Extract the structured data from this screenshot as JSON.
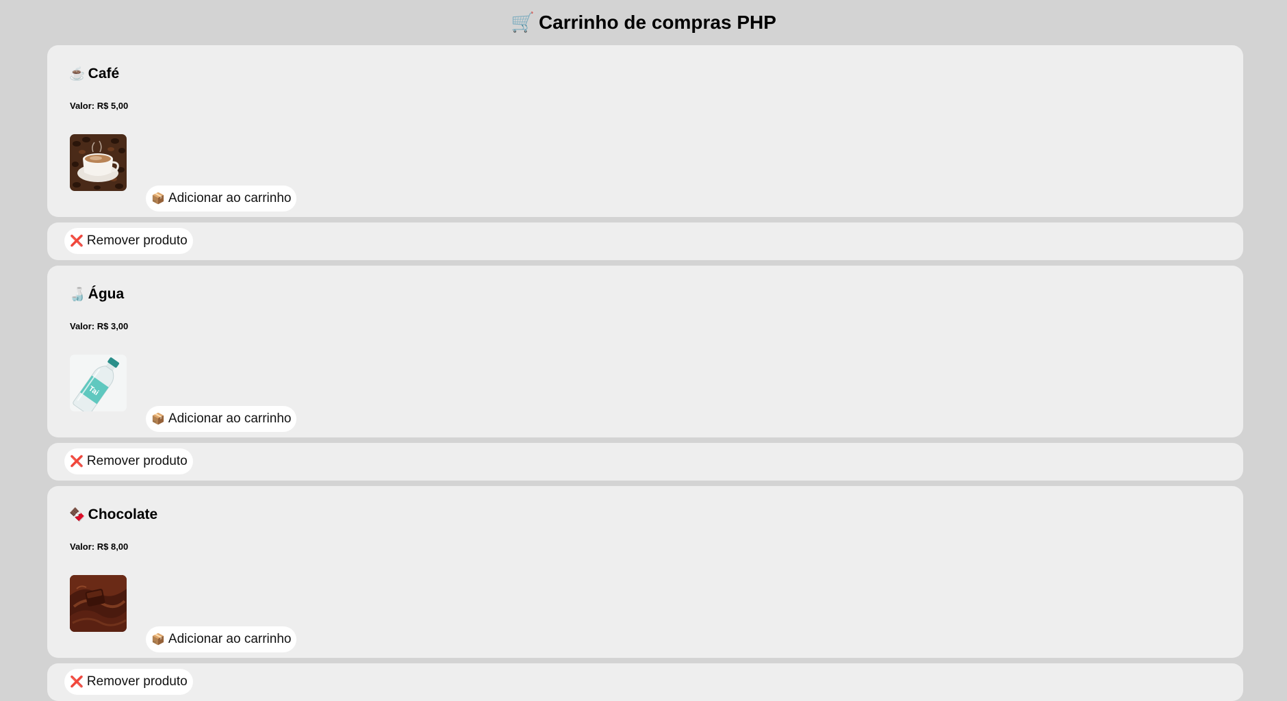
{
  "header": {
    "title": "Carrinho de compras PHP",
    "icon": "🛒"
  },
  "products": [
    {
      "icon": "☕",
      "name": "Café",
      "price": "Valor: R$ 5,00",
      "add_label": "Adicionar ao carrinho",
      "add_icon": "📦",
      "remove_label": "Remover produto",
      "remove_icon": "❌"
    },
    {
      "icon": "🍶",
      "name": "Água",
      "price": "Valor: R$ 3,00",
      "add_label": "Adicionar ao carrinho",
      "add_icon": "📦",
      "remove_label": "Remover produto",
      "remove_icon": "❌"
    },
    {
      "icon": "🍫",
      "name": "Chocolate",
      "price": "Valor: R$ 8,00",
      "add_label": "Adicionar ao carrinho",
      "add_icon": "📦",
      "remove_label": "Remover produto",
      "remove_icon": "❌"
    }
  ],
  "colors": {
    "page_background": "#d3d3d3",
    "card_background": "#eeeeee",
    "button_background": "#ffffff",
    "remove_icon_color": "#d9253a"
  }
}
